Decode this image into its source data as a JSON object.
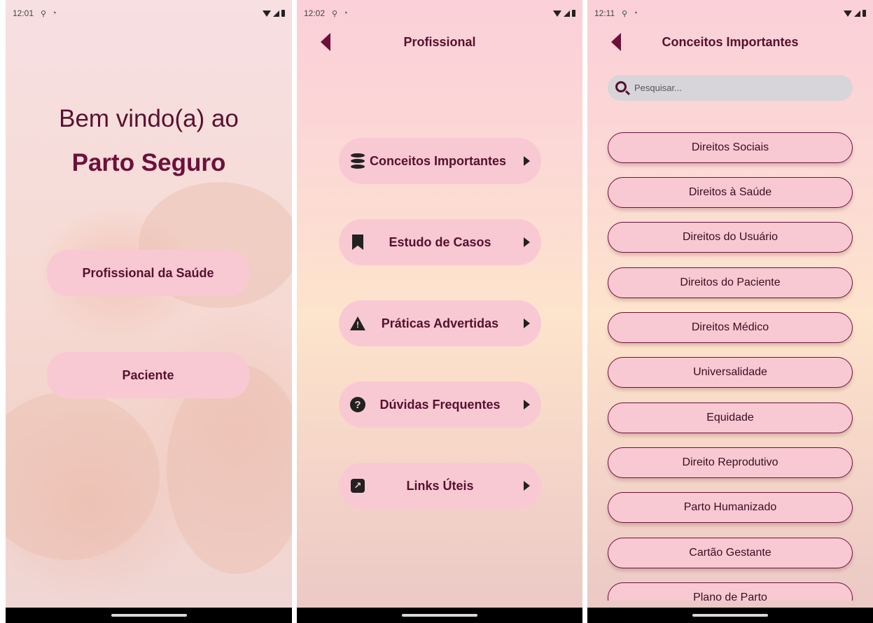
{
  "screen1": {
    "status": {
      "time": "12:01"
    },
    "welcome": "Bem vindo(a) ao",
    "app_name": "Parto Seguro",
    "buttons": {
      "professional": "Profissional da Saúde",
      "patient": "Paciente"
    }
  },
  "screen2": {
    "status": {
      "time": "12:02"
    },
    "title": "Profissional",
    "menu": [
      {
        "label": "Conceitos Importantes",
        "icon": "database-icon"
      },
      {
        "label": "Estudo de Casos",
        "icon": "bookmark-icon"
      },
      {
        "label": "Práticas Advertidas",
        "icon": "warning-icon"
      },
      {
        "label": "Dúvidas Frequentes",
        "icon": "question-icon"
      },
      {
        "label": "Links Úteis",
        "icon": "external-link-icon"
      }
    ]
  },
  "screen3": {
    "status": {
      "time": "12:11"
    },
    "title": "Conceitos Importantes",
    "search": {
      "placeholder": "Pesquisar..."
    },
    "items": [
      "Direitos Sociais",
      "Direitos à Saúde",
      "Direitos do Usuário",
      "Direitos do Paciente",
      "Direitos Médico",
      "Universalidade",
      "Equidade",
      "Direito Reprodutivo",
      "Parto Humanizado",
      "Cartão Gestante",
      "Plano de Parto"
    ]
  },
  "colors": {
    "accent": "#6e0f3a",
    "button_pink": "#f9c9d3",
    "search_gray": "#d7d5da",
    "nav_bar": "#000000"
  }
}
